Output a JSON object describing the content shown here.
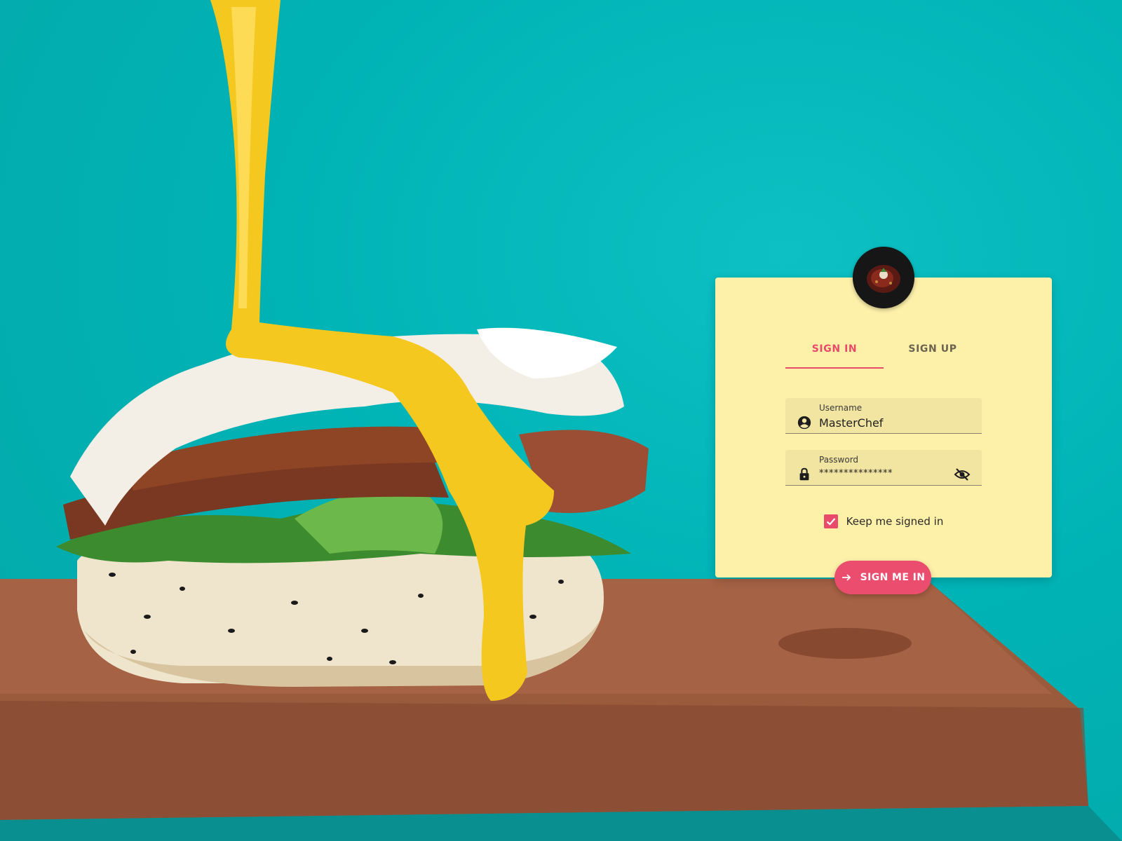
{
  "tabs": [
    {
      "label": "SIGN IN",
      "active": true
    },
    {
      "label": "SIGN UP",
      "active": false
    }
  ],
  "username": {
    "label": "Username",
    "value": "MasterChef",
    "icon": "account-circle-icon"
  },
  "password": {
    "label": "Password",
    "value": "***************",
    "icon": "lock-icon",
    "toggle_icon": "eye-off-icon"
  },
  "keep_signed_in": {
    "label": "Keep me signed in",
    "checked": true
  },
  "submit": {
    "label": "SIGN ME IN",
    "icon": "arrow-right-icon"
  },
  "colors": {
    "accent": "#e84a6a",
    "card": "#fdf0a9",
    "background": "#00b5b8"
  }
}
